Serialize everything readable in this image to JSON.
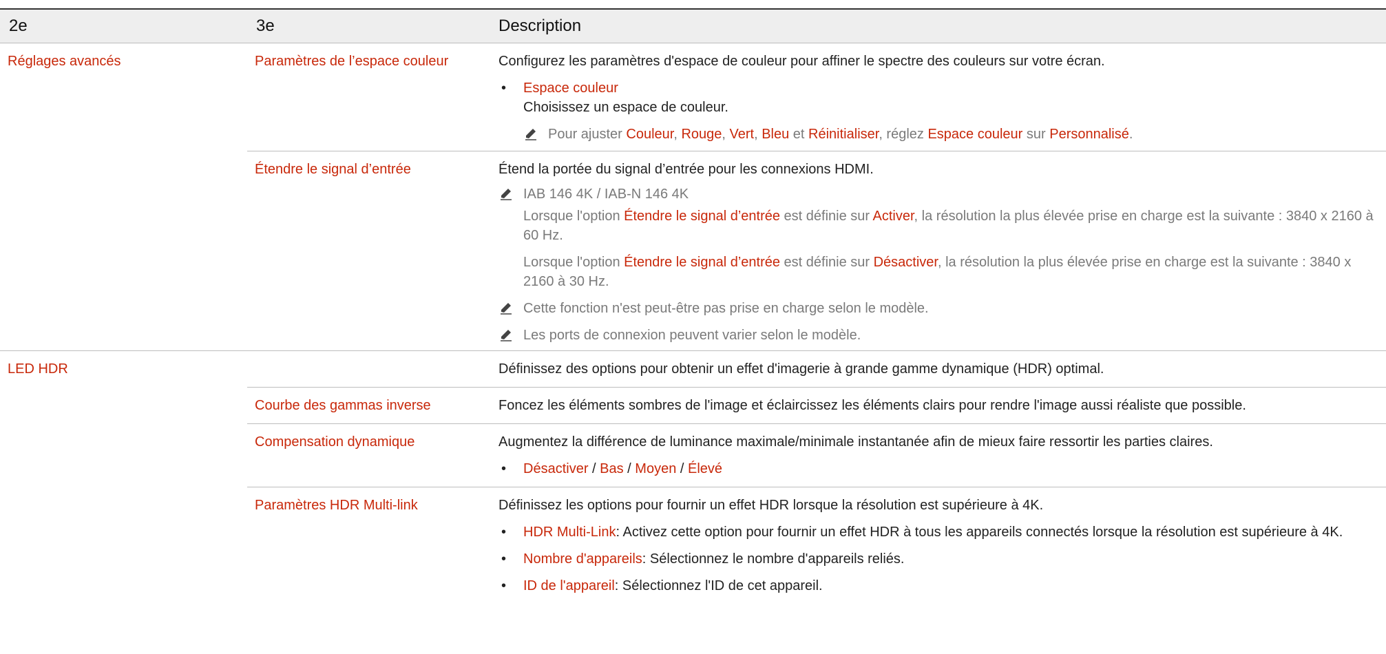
{
  "header": {
    "col1": "2e",
    "col2": "3e",
    "col3": "Description"
  },
  "rows": {
    "r1": {
      "c1": "Réglages avancés",
      "c2": "Paramètres de l’espace couleur",
      "desc": "Configurez les paramètres d'espace de couleur pour affiner le spectre des couleurs sur votre écran.",
      "bullet_title": "Espace couleur",
      "bullet_text": "Choisissez un espace de couleur.",
      "note": {
        "t1": "Pour ajuster ",
        "k1": "Couleur",
        "s1": ", ",
        "k2": "Rouge",
        "s2": ", ",
        "k3": "Vert",
        "s3": ", ",
        "k4": "Bleu",
        "s4": " et ",
        "k5": "Réinitialiser",
        "t2": ", réglez ",
        "k6": "Espace couleur",
        "t3": " sur ",
        "k7": "Personnalisé",
        "t4": "."
      }
    },
    "r2": {
      "c2": "Étendre le signal d’entrée",
      "desc": "Étend la portée du signal d’entrée pour les connexions HDMI.",
      "note1_title": "IAB 146 4K / IAB-N 146 4K",
      "p1": {
        "t1": "Lorsque l'option ",
        "k1": "Étendre le signal d’entrée",
        "t2": " est définie sur ",
        "k2": "Activer",
        "t3": ", la résolution la plus élevée prise en charge est la suivante : 3840 x 2160 à 60 Hz."
      },
      "p2": {
        "t1": "Lorsque l'option ",
        "k1": "Étendre le signal d’entrée",
        "t2": " est définie sur ",
        "k2": "Désactiver",
        "t3": ", la résolution la plus élevée prise en charge est la suivante : 3840 x 2160 à 30 Hz."
      },
      "note2": "Cette fonction n'est peut-être pas prise en charge selon le modèle.",
      "note3": "Les ports de connexion peuvent varier selon le modèle."
    },
    "r3": {
      "c1": "LED HDR",
      "desc": "Définissez des options pour obtenir un effet d'imagerie à grande gamme dynamique (HDR) optimal."
    },
    "r4": {
      "c2": "Courbe des gammas inverse",
      "desc": "Foncez les éléments sombres de l'image et éclaircissez les éléments clairs pour rendre l'image aussi réaliste que possible."
    },
    "r5": {
      "c2": "Compensation dynamique",
      "desc": "Augmentez la différence de luminance maximale/minimale instantanée afin de mieux faire ressortir les parties claires.",
      "opts": {
        "o1": "Désactiver",
        "o2": "Bas",
        "o3": "Moyen",
        "o4": "Élevé",
        "sep": " / "
      }
    },
    "r6": {
      "c2": "Paramètres HDR Multi-link",
      "desc": "Définissez les options pour fournir un effet HDR lorsque la résolution est supérieure à 4K.",
      "b1_key": "HDR Multi-Link",
      "b1_text": ": Activez cette option pour fournir un effet HDR à tous les appareils connectés lorsque la résolution est supérieure à 4K.",
      "b2_key": "Nombre d'appareils",
      "b2_text": ": Sélectionnez le nombre d'appareils reliés.",
      "b3_key": "ID de l'appareil",
      "b3_text": ": Sélectionnez l'ID de cet appareil."
    }
  },
  "glyphs": {
    "bullet": "•"
  },
  "icons": {
    "note": "pencil-note-icon"
  },
  "colors": {
    "accent": "#c8280a",
    "muted": "#7a7a7a",
    "header_bg": "#eeeeee"
  }
}
